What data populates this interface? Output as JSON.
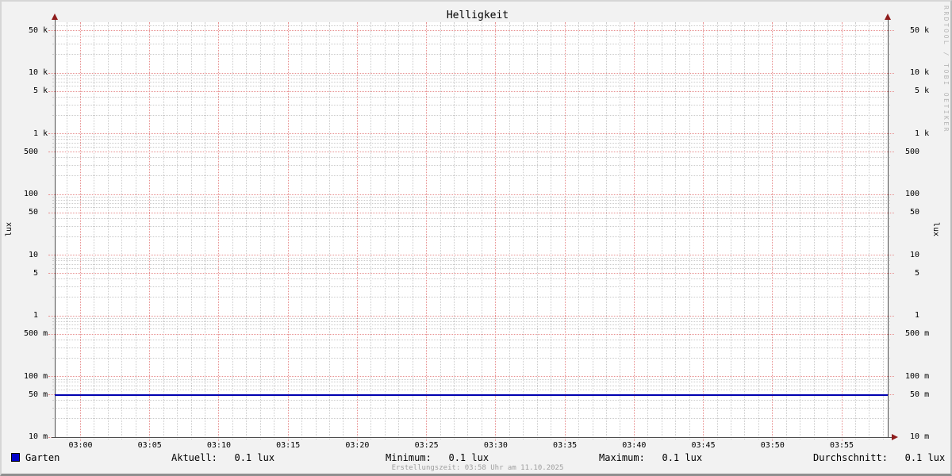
{
  "title": "Helligkeit",
  "y_axis_label_left": "lux",
  "y_axis_label_right": "lux",
  "watermark": "RRDTOOL / TOBI OETIKER",
  "footer": "Erstellungszeit: 03:58 Uhr am 11.10.2025",
  "legend": {
    "series_name": "Garten",
    "swatch_color": "#0000c8",
    "stats": [
      {
        "label": "Aktuell:",
        "value": "0.1 lux"
      },
      {
        "label": "Minimum:",
        "value": "0.1 lux"
      },
      {
        "label": "Maximum:",
        "value": "0.1 lux"
      },
      {
        "label": "Durchschnitt:",
        "value": "0.1 lux"
      }
    ]
  },
  "chart_data": {
    "type": "line",
    "title": "Helligkeit",
    "ylabel": "lux",
    "y_scale": "log",
    "ylim": [
      0.01,
      79000
    ],
    "x_range_minutes": [
      -1.86,
      58.3
    ],
    "x_major_tick_labels": [
      "03:00",
      "03:05",
      "03:10",
      "03:15",
      "03:20",
      "03:25",
      "03:30",
      "03:35",
      "03:40",
      "03:45",
      "03:50",
      "03:55"
    ],
    "x_minor_tick_every_minutes": 1,
    "y_major_ticks": [
      {
        "value": 50000,
        "label": "50 k"
      },
      {
        "value": 10000,
        "label": "10 k"
      },
      {
        "value": 5000,
        "label": "5 k"
      },
      {
        "value": 1000,
        "label": "1 k"
      },
      {
        "value": 500,
        "label": "500"
      },
      {
        "value": 100,
        "label": "100"
      },
      {
        "value": 50,
        "label": "50"
      },
      {
        "value": 10,
        "label": "10"
      },
      {
        "value": 5,
        "label": "5"
      },
      {
        "value": 1,
        "label": "1"
      },
      {
        "value": 0.5,
        "label": "500 m"
      },
      {
        "value": 0.1,
        "label": "100 m"
      },
      {
        "value": 0.05,
        "label": "50 m"
      },
      {
        "value": 0.01,
        "label": "10 m"
      }
    ],
    "y_minor_mantissas": [
      2,
      3,
      4,
      6,
      7,
      8,
      9
    ],
    "series": [
      {
        "name": "Garten",
        "color": "#0000b0",
        "shape": "constant-horizontal-line",
        "value_lux": 0.05
      }
    ],
    "legend_position": "bottom",
    "grid": {
      "major_color": "#e89090",
      "minor_color": "#cbcbcb",
      "style": "dotted"
    }
  }
}
